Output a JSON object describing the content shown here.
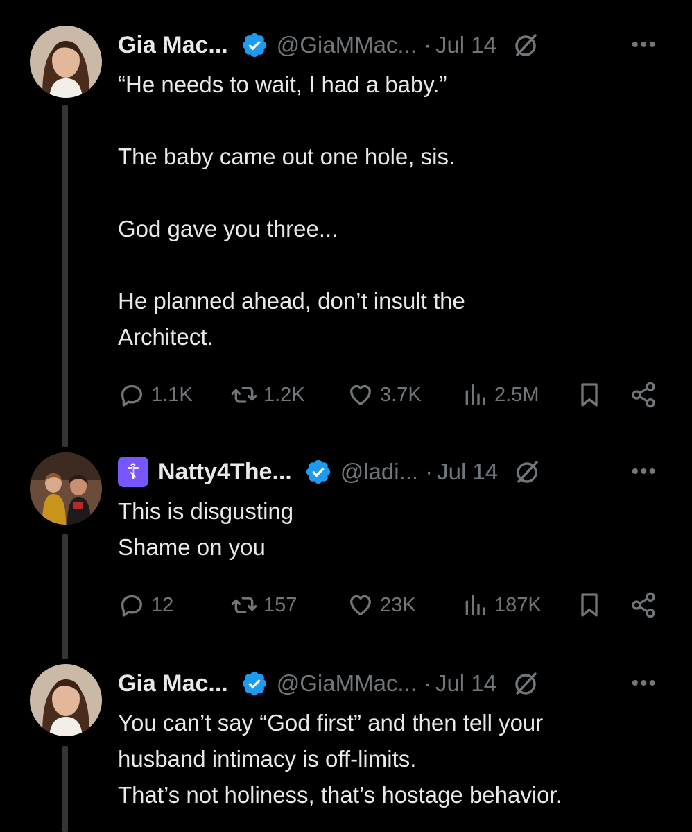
{
  "tweets": [
    {
      "name": "Gia Mac...",
      "handle": "@GiaMMac...",
      "dot": "·",
      "date": "Jul 14",
      "body": [
        "“He needs to wait, I had a baby.”",
        "",
        "The baby came out one hole, sis.",
        "",
        "God gave you three...",
        "",
        "He planned ahead, don’t insult the",
        "Architect."
      ],
      "replies": "1.1K",
      "reposts": "1.2K",
      "likes": "3.7K",
      "views": "2.5M"
    },
    {
      "badge": "☦",
      "name": "Natty4The...",
      "handle": "@ladi...",
      "dot": "·",
      "date": "Jul 14",
      "body": [
        "This is disgusting",
        "Shame on you"
      ],
      "replies": "12",
      "reposts": "157",
      "likes": "23K",
      "views": "187K"
    },
    {
      "name": "Gia Mac...",
      "handle": "@GiaMMac...",
      "dot": "·",
      "date": "Jul 14",
      "body": [
        "You can’t say “God first” and then tell your",
        "husband intimacy is off-limits.",
        "That’s not holiness, that’s hostage behavior."
      ]
    }
  ],
  "more_label": "•••",
  "colors": {
    "background": "#000000",
    "text": "#e7e9ea",
    "muted": "#71767b",
    "verified": "#1d9bf0",
    "thread_line": "#333639"
  },
  "icons": [
    "verified-badge-icon",
    "grok-icon",
    "more-icon",
    "reply-icon",
    "repost-icon",
    "like-icon",
    "views-icon",
    "bookmark-icon",
    "share-icon"
  ]
}
